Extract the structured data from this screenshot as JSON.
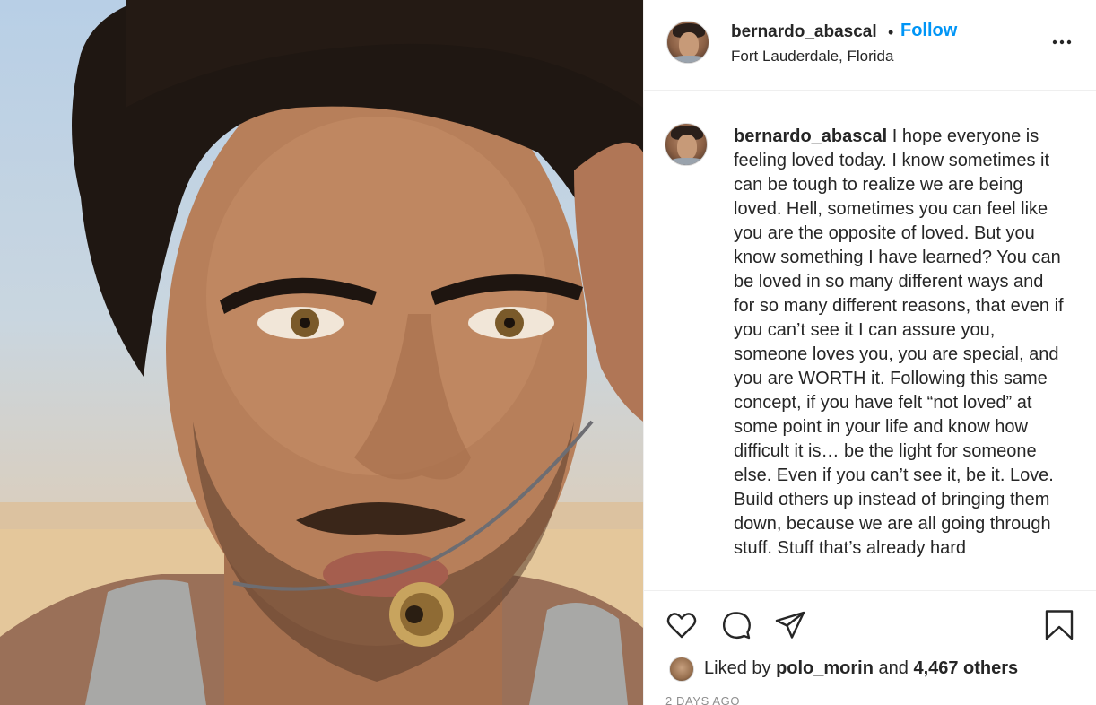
{
  "post": {
    "author": {
      "username": "bernardo_abascal",
      "location": "Fort Lauderdale, Florida"
    },
    "header": {
      "separator": "•",
      "follow_label": "Follow"
    },
    "caption": {
      "username": "bernardo_abascal",
      "text": "I hope everyone is feeling loved today. I know sometimes it can be tough to realize we are being loved. Hell, sometimes you can feel like you are the opposite of loved. But you know something I have learned? You can be loved in so many different ways and for so many different reasons, that even if you can’t see it I can assure you, someone loves you, you are special, and you are WORTH it. Following this same concept, if you have felt “not loved” at some point in your life and know how difficult it is… be the light for someone else. Even if you can’t see it, be it. Love. Build others up instead of bringing them down, because we are all going through stuff. Stuff that’s already hard"
    },
    "likes": {
      "prefix": "Liked by",
      "liker": "polo_morin",
      "connector": "and",
      "count": "4,467 others"
    },
    "timestamp": "2 DAYS AGO"
  },
  "icons": {
    "more": "more-options-icon",
    "like": "heart-icon",
    "comment": "comment-icon",
    "share": "share-icon",
    "save": "bookmark-icon"
  },
  "colors": {
    "accent": "#0095f6",
    "text": "#262626",
    "muted": "#8e8e8e",
    "divider": "#efefef"
  }
}
